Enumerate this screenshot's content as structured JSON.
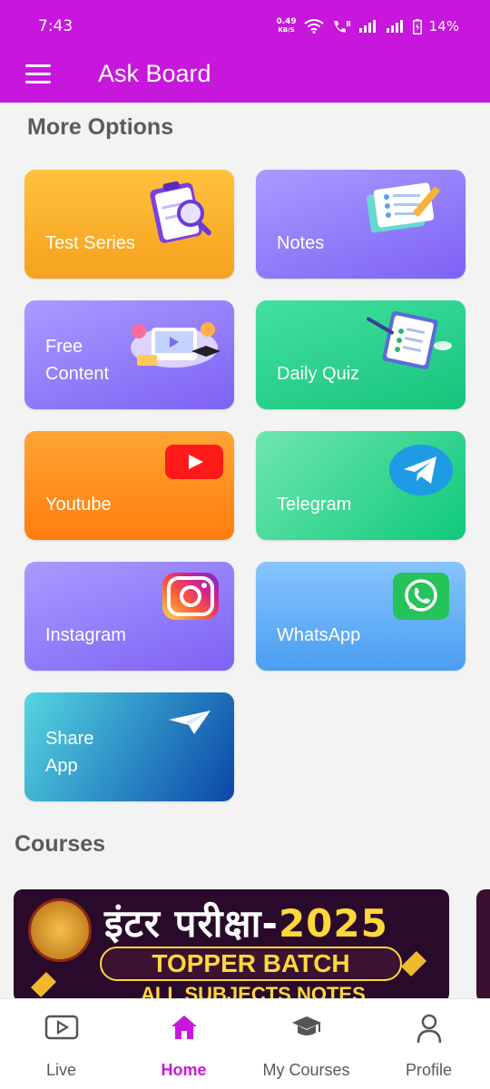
{
  "status": {
    "time": "7:43",
    "speed_top": "0.49",
    "speed_bottom": "KB/S",
    "battery": "14%"
  },
  "header": {
    "title": "Ask Board"
  },
  "sections": {
    "more_options": "More Options",
    "courses": "Courses"
  },
  "options": {
    "test_series": "Test Series",
    "notes": "Notes",
    "free_content": "Free\nContent",
    "daily_quiz": "Daily Quiz",
    "youtube": "Youtube",
    "telegram": "Telegram",
    "instagram": "Instagram",
    "whatsapp": "WhatsApp",
    "share_app": "Share\nApp"
  },
  "course_banner": {
    "headline": "इंटर परीक्षा-",
    "year": "2025",
    "pill": "TOPPER BATCH",
    "subtitle": "ALL SUBJECTS NOTES"
  },
  "bottom_nav": {
    "live": "Live",
    "home": "Home",
    "my_courses": "My Courses",
    "profile": "Profile"
  },
  "colors": {
    "accent": "#c717dc",
    "background": "#f3f3f4"
  }
}
